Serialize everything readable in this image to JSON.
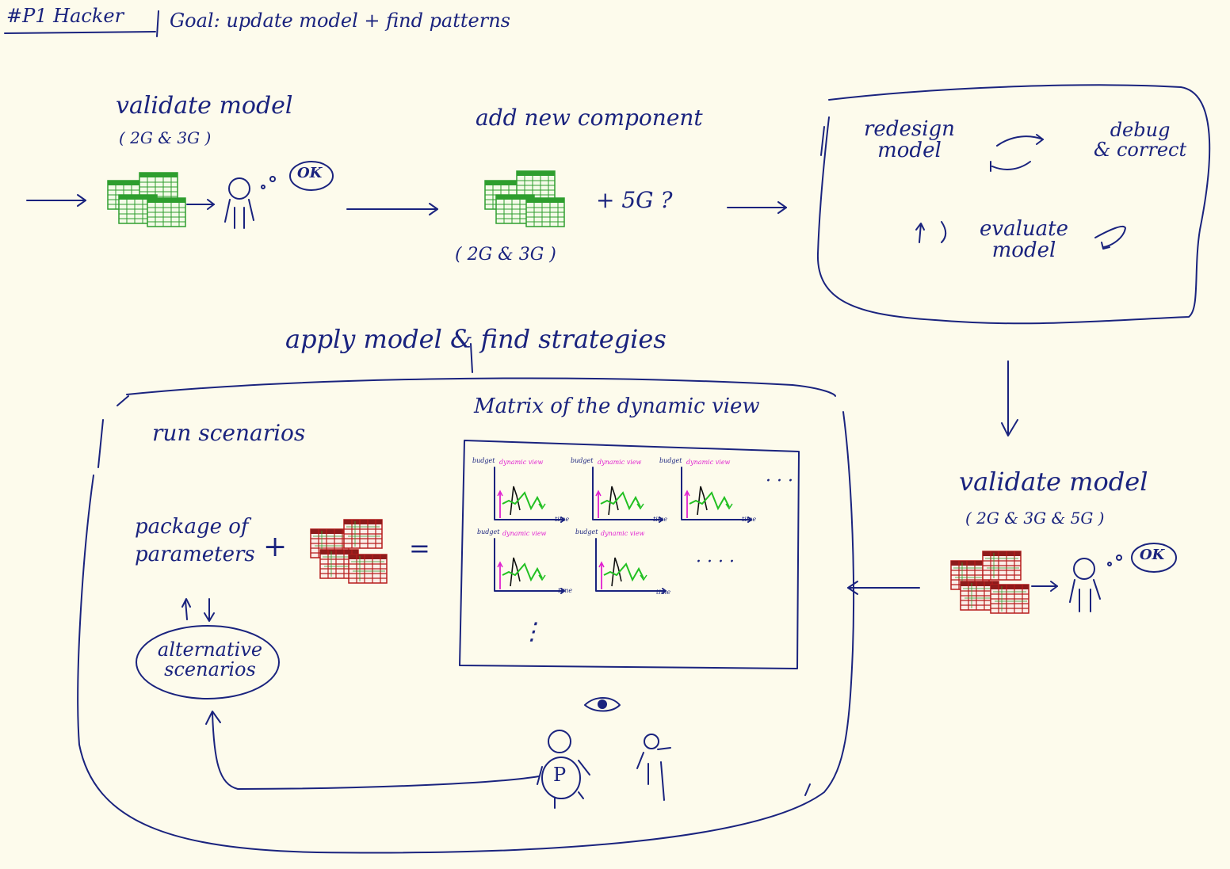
{
  "header": {
    "tag": "#P1 Hacker",
    "goal": "Goal: update model + find patterns"
  },
  "steps": {
    "validate_1": {
      "title": "validate model",
      "scope": "( 2G & 3G )",
      "ok": "OK"
    },
    "add_component": {
      "title": "add new component",
      "scope": "( 2G & 3G )",
      "plus": "+ 5G ?"
    },
    "loop": {
      "redesign_1": "redesign",
      "redesign_2": "model",
      "debug_1": "debug",
      "debug_2": "& correct",
      "evaluate_1": "evaluate",
      "evaluate_2": "model"
    },
    "validate_2": {
      "title": "validate model",
      "scope": "( 2G & 3G & 5G )",
      "ok": "OK"
    }
  },
  "apply": {
    "title": "apply model & find strategies",
    "run_scenarios": "run scenarios",
    "package_1": "package of",
    "package_2": "parameters",
    "plus": "+",
    "equals": "=",
    "alt_1": "alternative",
    "alt_2": "scenarios",
    "matrix_title": "Matrix of the dynamic view",
    "mini_ylabel": "budget",
    "mini_tag_1": "dynamic",
    "mini_tag_2": "view",
    "mini_xlabel": "time",
    "ellipsis_h": "· · ·",
    "ellipsis_h2": "· · · ·",
    "ellipsis_v": "⋮",
    "person_badge": "P"
  },
  "colors": {
    "ink": "#1a237e",
    "sheet_green": "#2e9e2e",
    "sheet_red": "#b71c1c",
    "magenta": "#e020d0",
    "bright_green": "#22c022"
  }
}
